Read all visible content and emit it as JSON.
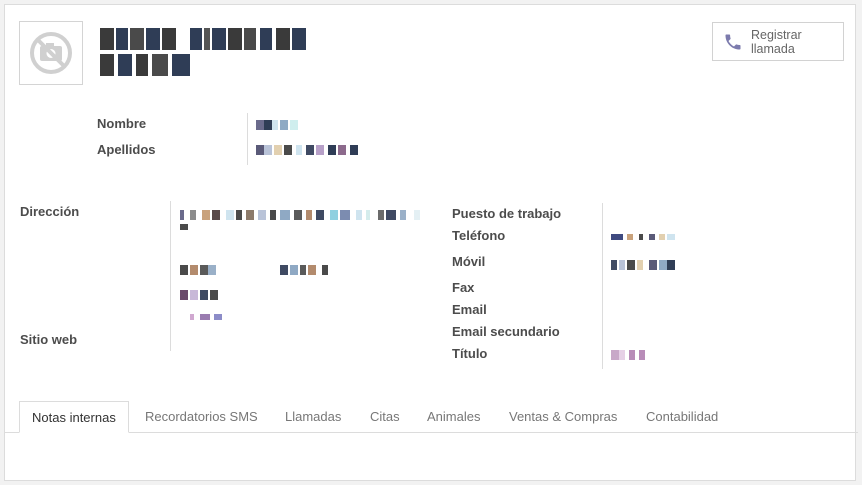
{
  "header": {
    "call_button_label": "Registrar llamada",
    "avatar_icon": "camera-off-icon",
    "call_icon": "phone-icon"
  },
  "name_fields": {
    "first_name_label": "Nombre",
    "last_name_label": "Apellidos"
  },
  "left_fields": {
    "address_label": "Dirección",
    "website_label": "Sitio web"
  },
  "right_fields": {
    "job_label": "Puesto de trabajo",
    "phone_label": "Teléfono",
    "mobile_label": "Móvil",
    "fax_label": "Fax",
    "email_label": "Email",
    "email2_label": "Email secundario",
    "title_label": "Título"
  },
  "tabs": [
    {
      "label": "Notas internas"
    },
    {
      "label": "Recordatorios SMS"
    },
    {
      "label": "Llamadas"
    },
    {
      "label": "Citas"
    },
    {
      "label": "Animales"
    },
    {
      "label": "Ventas & Compras"
    },
    {
      "label": "Contabilidad"
    }
  ],
  "colors": {
    "accent": "#7c7bad",
    "border": "#dcdcdc",
    "label": "#4c4c4c"
  }
}
